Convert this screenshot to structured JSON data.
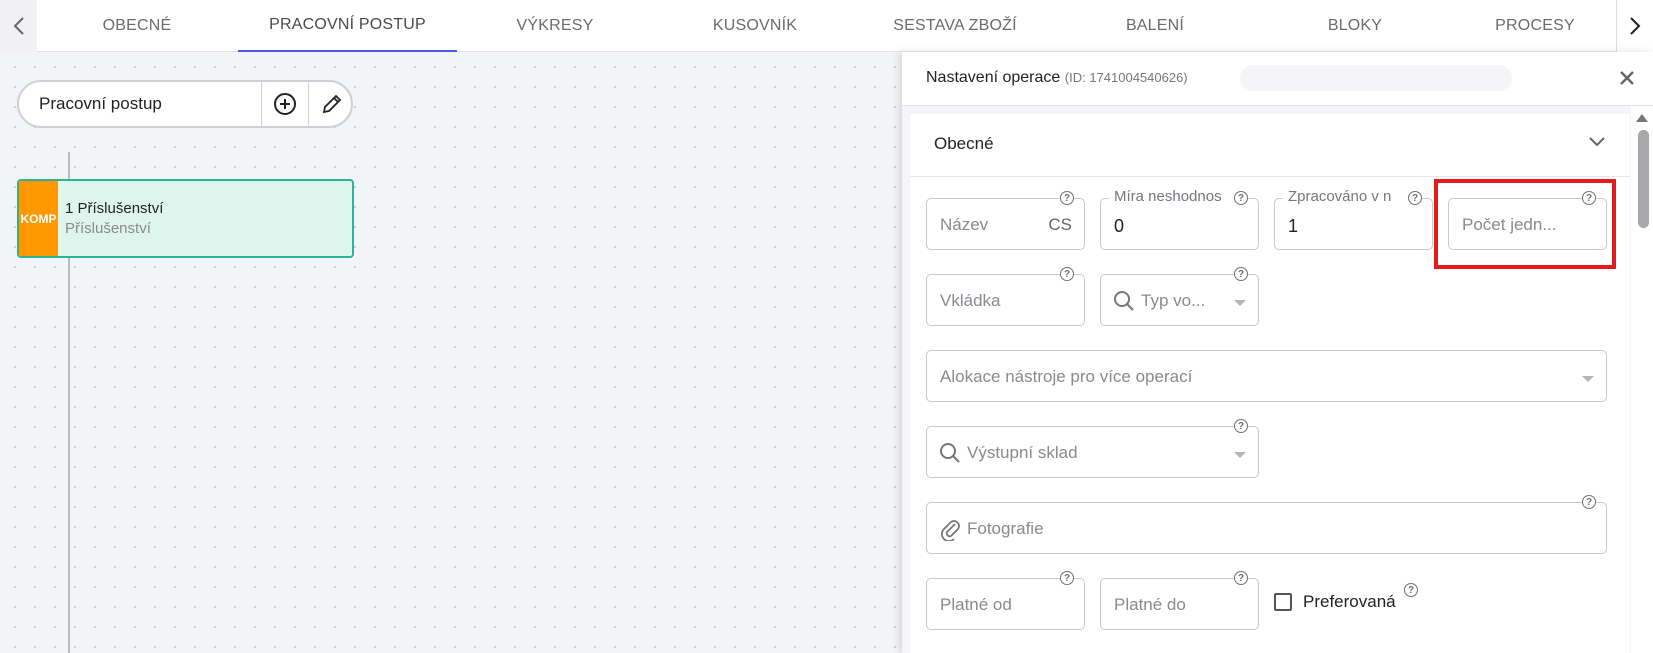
{
  "tabs": [
    {
      "label": "OBECNÉ"
    },
    {
      "label": "PRACOVNÍ POSTUP"
    },
    {
      "label": "VÝKRESY"
    },
    {
      "label": "KUSOVNÍK"
    },
    {
      "label": "SESTAVA ZBOŽÍ"
    },
    {
      "label": "BALENÍ"
    },
    {
      "label": "BLOKY"
    },
    {
      "label": "PROCESY"
    }
  ],
  "workflow": {
    "title": "Pracovní postup",
    "node": {
      "tag": "KOMP",
      "title": "1 Příslušenství",
      "subtitle": "Příslušenství"
    }
  },
  "panel": {
    "title": "Nastavení operace",
    "id_text": "(ID: 1741004540626)",
    "section_title": "Obecné",
    "fields": {
      "nazev": {
        "label": "Název",
        "suffix": "CS"
      },
      "mira": {
        "caption": "Míra neshodnos",
        "value": "0"
      },
      "zpracovano": {
        "caption": "Zpracováno v n",
        "value": "1"
      },
      "pocet": {
        "label": "Počet jedn..."
      },
      "vkladka": {
        "label": "Vkládka"
      },
      "typ": {
        "label": "Typ vo..."
      },
      "alokace": {
        "label": "Alokace nástroje pro více operací"
      },
      "sklad": {
        "label": "Výstupní sklad"
      },
      "foto": {
        "label": "Fotografie"
      },
      "platne_od": {
        "label": "Platné od"
      },
      "platne_do": {
        "label": "Platné do"
      },
      "preferovana": {
        "label": "Preferovaná",
        "checked": false
      }
    }
  },
  "colors": {
    "accent": "#4a5be0",
    "node_border": "#2bb39a",
    "node_bg": "#def5ee",
    "tag_bg": "#ff9800",
    "highlight": "#e31b1b"
  }
}
